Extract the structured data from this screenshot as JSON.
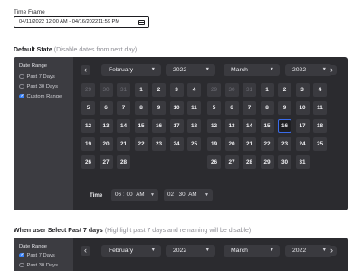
{
  "time_frame": {
    "label": "Time Frame",
    "value": "04/11/2022 12:00 AM - 04/16/202211:59 PM",
    "icon": "calendar-icon"
  },
  "default_state": {
    "title": "Default State",
    "hint": "(Disable dates from next day)",
    "sidebar": {
      "title": "Date Range",
      "options": [
        {
          "label": "Past 7 Days",
          "checked": false
        },
        {
          "label": "Past 30 Days",
          "checked": false
        },
        {
          "label": "Custom Range",
          "checked": true
        }
      ]
    },
    "prev_label": "‹",
    "next_label": "›",
    "left_month": "February",
    "left_year": "2022",
    "right_month": "March",
    "right_year": "2022",
    "left_days": [
      [
        "29",
        "30",
        "31",
        "1",
        "2",
        "3",
        "4"
      ],
      [
        "5",
        "6",
        "7",
        "8",
        "9",
        "10",
        "11"
      ],
      [
        "12",
        "13",
        "14",
        "15",
        "16",
        "17",
        "18"
      ],
      [
        "19",
        "20",
        "21",
        "22",
        "23",
        "24",
        "25"
      ],
      [
        "26",
        "27",
        "28",
        "",
        "",
        "",
        ""
      ]
    ],
    "right_days": [
      [
        "29",
        "30",
        "31",
        "1",
        "2",
        "3",
        "4"
      ],
      [
        "5",
        "6",
        "7",
        "8",
        "9",
        "10",
        "11"
      ],
      [
        "12",
        "13",
        "14",
        "15",
        "16",
        "17",
        "18"
      ],
      [
        "19",
        "20",
        "21",
        "22",
        "23",
        "24",
        "25"
      ],
      [
        "26",
        "27",
        "28",
        "29",
        "30",
        "31",
        ""
      ]
    ],
    "today": "16",
    "time": {
      "label": "Time",
      "start_hour": "06",
      "start_min": "00",
      "start_period": "AM",
      "end_hour": "02",
      "end_min": "30",
      "end_period": "AM"
    }
  },
  "past7_state": {
    "title": "When user Select Past 7 days",
    "hint": "(Highlight past 7 days and remaining will be disable)",
    "sidebar": {
      "title": "Date Range",
      "options": [
        {
          "label": "Past 7 Days",
          "checked": true
        },
        {
          "label": "Past 30 Days",
          "checked": false
        }
      ]
    },
    "left_month": "February",
    "left_year": "2022",
    "right_month": "March",
    "right_year": "2022"
  }
}
